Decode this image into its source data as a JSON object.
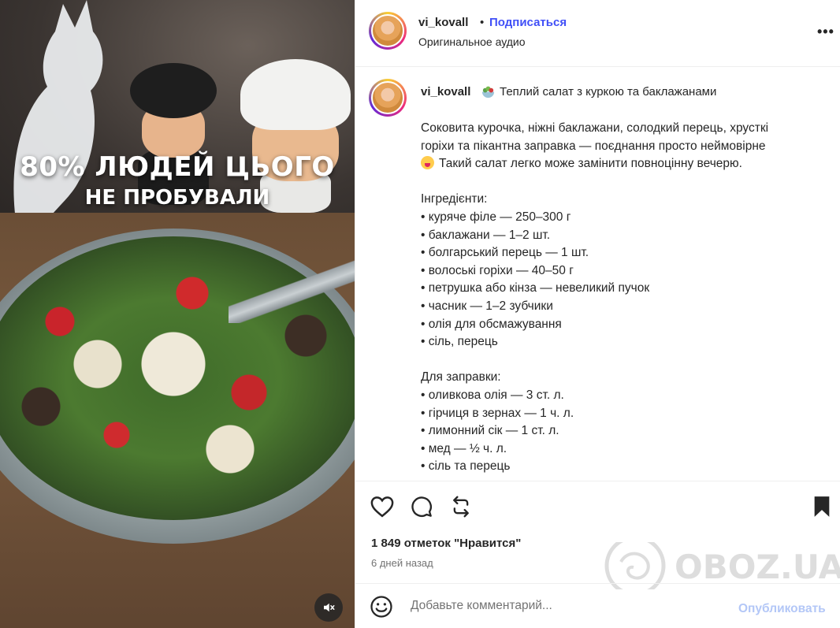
{
  "media": {
    "overlay_line1": "80% ЛЮДЕЙ ЦЬОГО",
    "overlay_line2": "НЕ ПРОБУВАЛИ",
    "mute_icon": "speaker-muted-icon"
  },
  "header": {
    "username": "vi_kovall",
    "separator": "•",
    "follow_label": "Подписаться",
    "audio_label": "Оригинальное аудио",
    "more_label": "•••"
  },
  "caption": {
    "username": "vi_kovall",
    "title": "Теплий салат з куркою та баклажанами",
    "intro_lines": [
      "Соковита курочка, ніжні баклажани, солодкий перець, хрусткі",
      "горіхи та пікантна заправка — поєднання просто неймовірне",
      "Такий салат легко може замінити повноцінну вечерю."
    ],
    "ingredients_heading": "Інгредієнти:",
    "ingredients": [
      "• куряче філе — 250–300 г",
      "• баклажани — 1–2 шт.",
      "• болгарський перець — 1 шт.",
      "• волоські горіхи — 40–50 г",
      "• петрушка або кінза — невеликий пучок",
      "• часник — 1–2 зубчики",
      "• олія для обсмажування",
      "• сіль, перець"
    ],
    "dressing_heading": "Для заправки:",
    "dressing": [
      "• оливкова олія — 3 ст. л.",
      "• гірчиця в зернах — 1 ч. л.",
      "• лимонний сік — 1 ст. л.",
      "• мед — ½ ч. л.",
      "• сіль та перець"
    ]
  },
  "actions": {
    "likes_text": "1 849 отметок \"Нравится\"",
    "time_text": "6 дней назад",
    "icons": [
      "heart-icon",
      "comment-icon",
      "repost-icon",
      "bookmark-icon"
    ]
  },
  "watermark": {
    "text": "OBOZ.UA"
  },
  "comment": {
    "placeholder": "Добавьте комментарий...",
    "publish_label": "Опубликовать"
  },
  "colors": {
    "accent": "#4150f7",
    "publish_disabled": "#b3c7f7",
    "text": "#262626",
    "muted": "#737373"
  }
}
